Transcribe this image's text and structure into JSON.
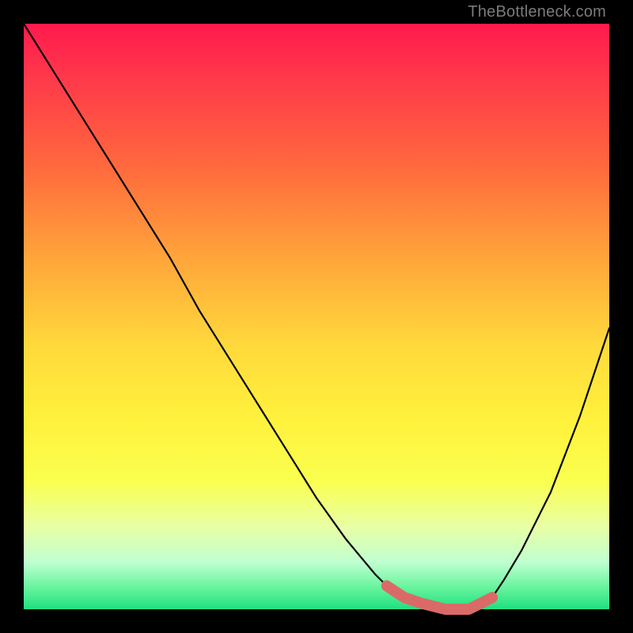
{
  "watermark": "TheBottleneck.com",
  "colors": {
    "gradient_top": "#ff1a4d",
    "gradient_mid": "#ffd93b",
    "gradient_bottom": "#1fe07f",
    "frame": "#000000",
    "curve": "#000000",
    "highlight": "#da6a68"
  },
  "chart_data": {
    "type": "line",
    "title": "",
    "xlabel": "",
    "ylabel": "",
    "xlim": [
      0,
      100
    ],
    "ylim": [
      0,
      100
    ],
    "series": [
      {
        "name": "bottleneck-curve",
        "x": [
          0,
          5,
          10,
          15,
          20,
          25,
          30,
          35,
          40,
          45,
          50,
          55,
          60,
          62,
          65,
          68,
          72,
          76,
          80,
          82,
          85,
          90,
          95,
          100
        ],
        "values": [
          100,
          92,
          84,
          76,
          68,
          60,
          51,
          43,
          35,
          27,
          19,
          12,
          6,
          4,
          2,
          1,
          0,
          0,
          2,
          5,
          10,
          20,
          33,
          48
        ]
      }
    ],
    "highlight_segment": {
      "x": [
        62,
        65,
        68,
        72,
        76,
        80
      ],
      "values": [
        4,
        2,
        1,
        0,
        0,
        2
      ],
      "color": "#da6a68"
    }
  }
}
